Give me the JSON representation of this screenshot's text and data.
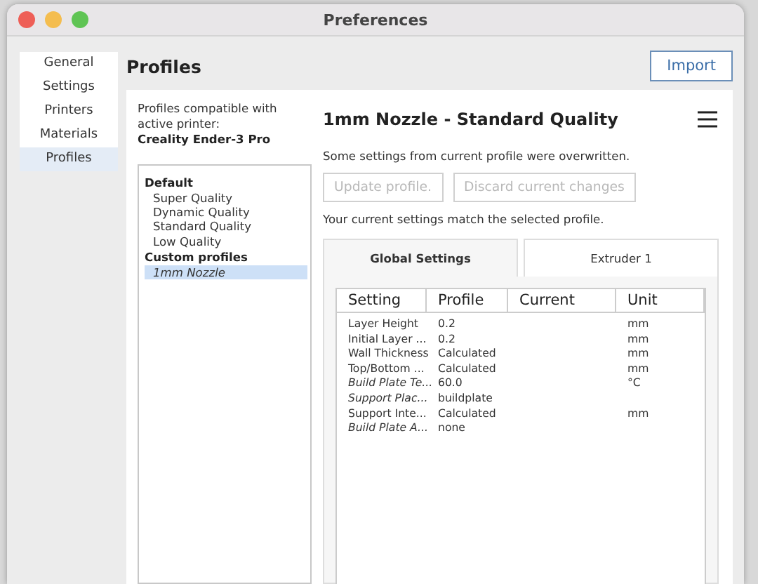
{
  "window": {
    "title": "Preferences"
  },
  "sidebar": {
    "items": [
      {
        "label": "General",
        "selected": false
      },
      {
        "label": "Settings",
        "selected": false
      },
      {
        "label": "Printers",
        "selected": false
      },
      {
        "label": "Materials",
        "selected": false
      },
      {
        "label": "Profiles",
        "selected": true
      }
    ]
  },
  "heading": "Profiles",
  "import_button": "Import",
  "compatible_text": "Profiles compatible with active printer:",
  "printer_name": "Creality Ender-3 Pro",
  "profile_groups": [
    {
      "title": "Default",
      "items": [
        {
          "label": "Super Quality",
          "selected": false
        },
        {
          "label": "Dynamic Quality",
          "selected": false
        },
        {
          "label": "Standard Quality",
          "selected": false
        },
        {
          "label": "Low Quality",
          "selected": false
        }
      ]
    },
    {
      "title": "Custom profiles",
      "items": [
        {
          "label": "1mm Nozzle",
          "selected": true
        }
      ]
    }
  ],
  "profile_title": "1mm Nozzle - Standard Quality",
  "overwritten_text": "Some settings from current profile were overwritten.",
  "buttons": [
    {
      "label": "Update profile.",
      "disabled": true
    },
    {
      "label": "Discard current changes",
      "disabled": true
    }
  ],
  "match_text": "Your current settings match the selected profile.",
  "tabs": [
    {
      "label": "Global Settings",
      "selected": true
    },
    {
      "label": "Extruder 1",
      "selected": false
    }
  ],
  "table": {
    "columns": [
      "Setting",
      "Profile",
      "Current",
      "Unit"
    ],
    "rows": [
      {
        "setting": "Layer Height",
        "profile": "0.2",
        "unit": "mm",
        "italic": false
      },
      {
        "setting": "Initial Layer ...",
        "profile": "0.2",
        "unit": "mm",
        "italic": false
      },
      {
        "setting": "Wall Thickness",
        "profile": "Calculated",
        "unit": "mm",
        "italic": false
      },
      {
        "setting": "Top/Bottom ...",
        "profile": "Calculated",
        "unit": "mm",
        "italic": false
      },
      {
        "setting": "Build Plate Te...",
        "profile": "60.0",
        "unit": "°C",
        "italic": true
      },
      {
        "setting": "Support Plac...",
        "profile": "buildplate",
        "italic": true
      },
      {
        "setting": "Support Inte...",
        "profile": "Calculated",
        "unit": "mm",
        "italic": false
      },
      {
        "setting": "Build Plate A...",
        "profile": "none",
        "italic": true
      }
    ]
  }
}
